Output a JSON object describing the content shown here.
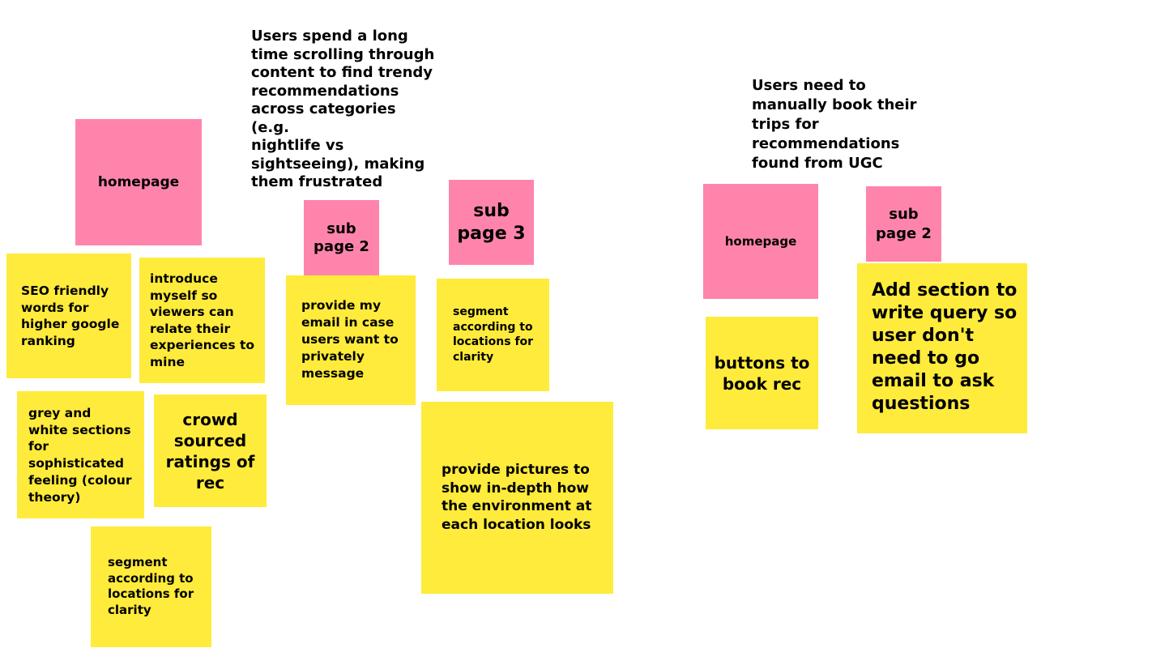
{
  "colors": {
    "background": "#ffffff",
    "pink_note": "#ff84ac",
    "yellow_note": "#ffeb3b"
  },
  "headings": {
    "problem_1": "Users spend a long\ntime scrolling through\ncontent to find trendy\nrecommendations\nacross categories (e.g.\nnightlife vs\nsightseeing), making\nthem frustrated",
    "problem_2": "Users need to\nmanually book their\ntrips for\nrecommendations\nfound from UGC"
  },
  "notes": {
    "homepage_1": "homepage",
    "sub_page_2_a": "sub\npage 2",
    "sub_page_3": "sub\npage 3",
    "homepage_2": "homepage",
    "sub_page_2_b": "sub\npage 2",
    "seo": "SEO friendly\nwords for\nhigher google\nranking",
    "introduce": "introduce\nmyself so\nviewers can\nrelate their\nexperiences to\nmine",
    "grey_white": "grey and\nwhite sections\nfor\nsophisticated\nfeeling (colour\ntheory)",
    "crowd": "crowd\nsourced\nratings of\nrec",
    "segment_1": "segment\naccording to\nlocations for\nclarity",
    "email": "provide my\nemail in case\nusers want to\nprivately\nmessage",
    "segment_2": "segment\naccording to\nlocations for\nclarity",
    "pictures": "provide pictures to\nshow in-depth how\nthe environment at\neach location looks",
    "buttons": "buttons to\nbook rec",
    "query": "Add section to\nwrite query so\nuser don't\nneed to go\nemail to ask\nquestions"
  }
}
